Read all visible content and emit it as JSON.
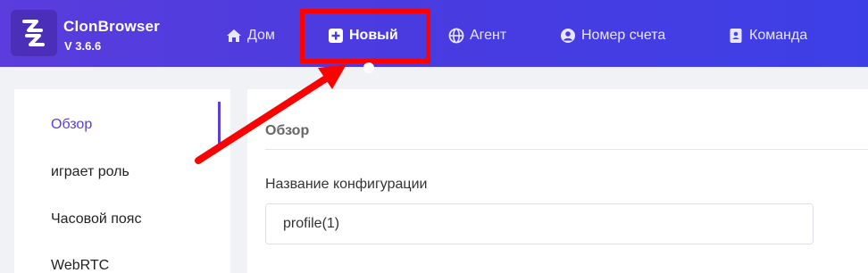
{
  "app": {
    "name": "ClonBrowser",
    "version": "V 3.6.6"
  },
  "nav": {
    "items": [
      {
        "label": "Дом",
        "icon": "home-icon"
      },
      {
        "label": "Новый",
        "icon": "plus-square-icon"
      },
      {
        "label": "Агент",
        "icon": "globe-icon"
      },
      {
        "label": "Номер счета",
        "icon": "user-circle-icon"
      },
      {
        "label": "Команда",
        "icon": "address-book-icon"
      }
    ],
    "active": "Новый"
  },
  "sidebar": {
    "items": [
      {
        "label": "Обзор"
      },
      {
        "label": "играет роль"
      },
      {
        "label": "Часовой пояс"
      },
      {
        "label": "WebRTC"
      }
    ],
    "active": "Обзор"
  },
  "main": {
    "section_title": "Обзор",
    "config_name": {
      "label": "Название конфигурации",
      "value": "profile(1)"
    }
  },
  "colors": {
    "accent": "#5b3fd9",
    "header_start": "#5a3ddc",
    "header_end": "#3d3fe6",
    "annotation": "#ff0000"
  }
}
